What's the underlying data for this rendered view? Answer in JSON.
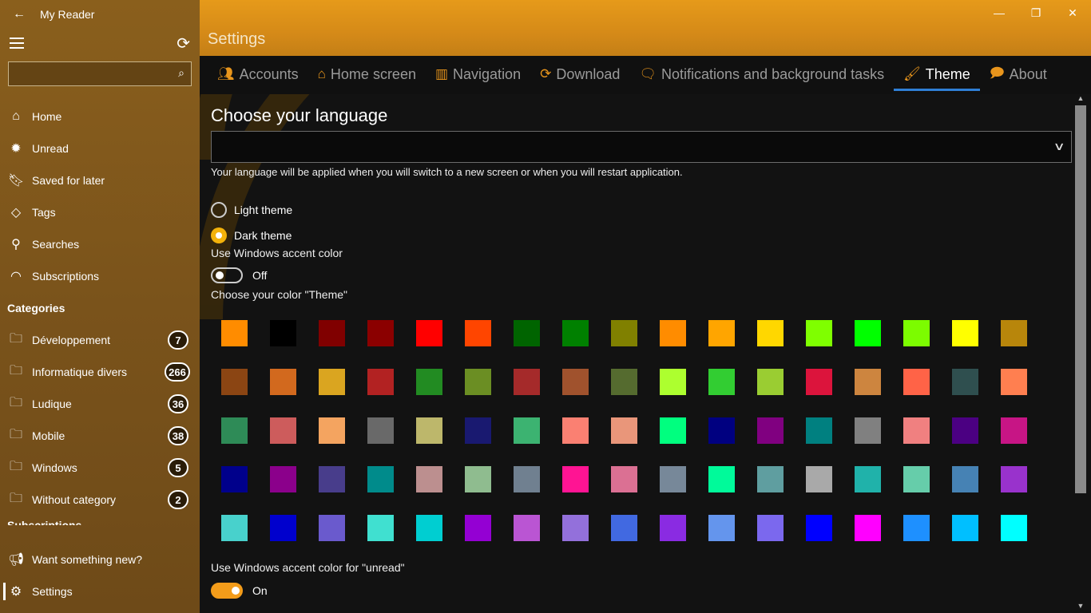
{
  "app": {
    "title": "My Reader"
  },
  "sidebar": {
    "search_placeholder": "",
    "nav": [
      {
        "label": "Home",
        "icon": "home-icon"
      },
      {
        "label": "Unread",
        "icon": "new-icon"
      },
      {
        "label": "Saved for later",
        "icon": "bookmark-icon"
      },
      {
        "label": "Tags",
        "icon": "tag-icon"
      },
      {
        "label": "Searches",
        "icon": "search-icon"
      },
      {
        "label": "Subscriptions",
        "icon": "rss-icon"
      }
    ],
    "categories_title": "Categories",
    "categories": [
      {
        "label": "Développement",
        "count": "7"
      },
      {
        "label": "Informatique divers",
        "count": "266"
      },
      {
        "label": "Ludique",
        "count": "36"
      },
      {
        "label": "Mobile",
        "count": "38"
      },
      {
        "label": "Windows",
        "count": "5"
      },
      {
        "label": "Without category",
        "count": "2"
      }
    ],
    "subscriptions_title": "Subscriptions",
    "bottom": [
      {
        "label": "Want something new?",
        "icon": "megaphone-icon"
      },
      {
        "label": "Settings",
        "icon": "gear-icon"
      }
    ]
  },
  "main": {
    "page_title": "Settings",
    "tabs": [
      {
        "label": "Accounts",
        "icon": "people-icon"
      },
      {
        "label": "Home screen",
        "icon": "home-icon"
      },
      {
        "label": "Navigation",
        "icon": "columns-icon"
      },
      {
        "label": "Download",
        "icon": "sync-icon"
      },
      {
        "label": "Notifications and background tasks",
        "icon": "chat-icon"
      },
      {
        "label": "Theme",
        "icon": "brush-icon",
        "active": true
      },
      {
        "label": "About",
        "icon": "speech-icon"
      }
    ],
    "language": {
      "heading": "Choose your language",
      "selected": "",
      "note": "Your language will be applied when you will switch to a new screen or when you will restart application."
    },
    "theme": {
      "light_label": "Light theme",
      "dark_label": "Dark theme",
      "selected": "dark",
      "accent_label": "Use Windows accent color",
      "accent_state": "Off",
      "color_label": "Choose your color \"Theme\"",
      "unread_label": "Use Windows accent color for \"unread\"",
      "unread_state": "On"
    },
    "colors": [
      "#FF8C00",
      "#000000",
      "#800000",
      "#8B0000",
      "#FF0000",
      "#FF4500",
      "#006400",
      "#008000",
      "#808000",
      "#FF8C00",
      "#FFA500",
      "#FFD700",
      "#7FFF00",
      "#00FF00",
      "#7CFC00",
      "#FFFF00",
      "#B8860B",
      "#8B4513",
      "#D2691E",
      "#DAA520",
      "#B22222",
      "#228B22",
      "#6B8E23",
      "#A52A2A",
      "#A0522D",
      "#556B2F",
      "#ADFF2F",
      "#32CD32",
      "#9ACD32",
      "#DC143C",
      "#CD853F",
      "#FF6347",
      "#2F4F4F",
      "#FF7F50",
      "#2E8B57",
      "#CD5C5C",
      "#F4A460",
      "#696969",
      "#BDB76B",
      "#191970",
      "#3CB371",
      "#FA8072",
      "#E9967A",
      "#00FF7F",
      "#000080",
      "#800080",
      "#008080",
      "#808080",
      "#F08080",
      "#4B0082",
      "#C71585",
      "#00008B",
      "#8B008B",
      "#483D8B",
      "#008B8B",
      "#BC8F8F",
      "#8FBC8F",
      "#708090",
      "#FF1493",
      "#DB7093",
      "#778899",
      "#00FA9A",
      "#5F9EA0",
      "#A9A9A9",
      "#20B2AA",
      "#66CDAA",
      "#4682B4",
      "#9932CC",
      "#48D1CC",
      "#0000CD",
      "#6A5ACD",
      "#40E0D0",
      "#00CED1",
      "#9400D3",
      "#BA55D3",
      "#9370DB",
      "#4169E1",
      "#8A2BE2",
      "#6495ED",
      "#7B68EE",
      "#0000FF",
      "#FF00FF",
      "#1E90FF",
      "#00BFFF",
      "#00FFFF"
    ],
    "accent": "#F39C1A"
  },
  "window": {
    "minimize": "—",
    "restore": "❐",
    "close": "✕"
  }
}
